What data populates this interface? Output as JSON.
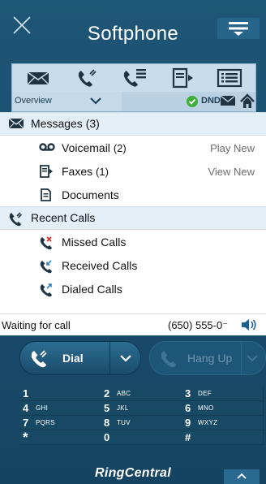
{
  "window": {
    "title": "Softphone"
  },
  "toolbar": {
    "icons": [
      "envelope-icon",
      "phone-icon",
      "phone-list-icon",
      "fax-icon",
      "list-icon"
    ]
  },
  "nav": {
    "view": "Overview",
    "dnd_label": "DND"
  },
  "messages": {
    "title": "Messages",
    "count": "(3)",
    "items": [
      {
        "label": "Voicemail",
        "count": "(2)",
        "action": "Play New",
        "icon": "voicemail-icon"
      },
      {
        "label": "Faxes",
        "count": "(1)",
        "action": "View New",
        "icon": "fax-icon"
      },
      {
        "label": "Documents",
        "count": "",
        "action": "",
        "icon": "document-icon"
      }
    ]
  },
  "recent_calls": {
    "title": "Recent Calls",
    "items": [
      {
        "label": "Missed Calls",
        "icon": "missed-call-icon"
      },
      {
        "label": "Received Calls",
        "icon": "received-call-icon"
      },
      {
        "label": "Dialed Calls",
        "icon": "dialed-call-icon"
      }
    ]
  },
  "status": {
    "text": "Waiting for call",
    "phone": "(650) 555-0⁻"
  },
  "call": {
    "dial_label": "Dial",
    "hangup_label": "Hang Up"
  },
  "keypad": [
    {
      "num": "1",
      "letters": ""
    },
    {
      "num": "2",
      "letters": "ABC"
    },
    {
      "num": "3",
      "letters": "DEF"
    },
    {
      "num": "4",
      "letters": "GHI"
    },
    {
      "num": "5",
      "letters": "JKL"
    },
    {
      "num": "6",
      "letters": "MNO"
    },
    {
      "num": "7",
      "letters": "PQRS"
    },
    {
      "num": "8",
      "letters": "TUV"
    },
    {
      "num": "9",
      "letters": "WXYZ"
    },
    {
      "num": "*",
      "letters": ""
    },
    {
      "num": "0",
      "letters": ""
    },
    {
      "num": "#",
      "letters": ""
    }
  ],
  "brand": "RingCentral",
  "colors": {
    "background": "#1c4f6f",
    "toolbar": "#c9dceb",
    "dnd_green": "#3fae3a",
    "missed_red": "#d9332b"
  }
}
